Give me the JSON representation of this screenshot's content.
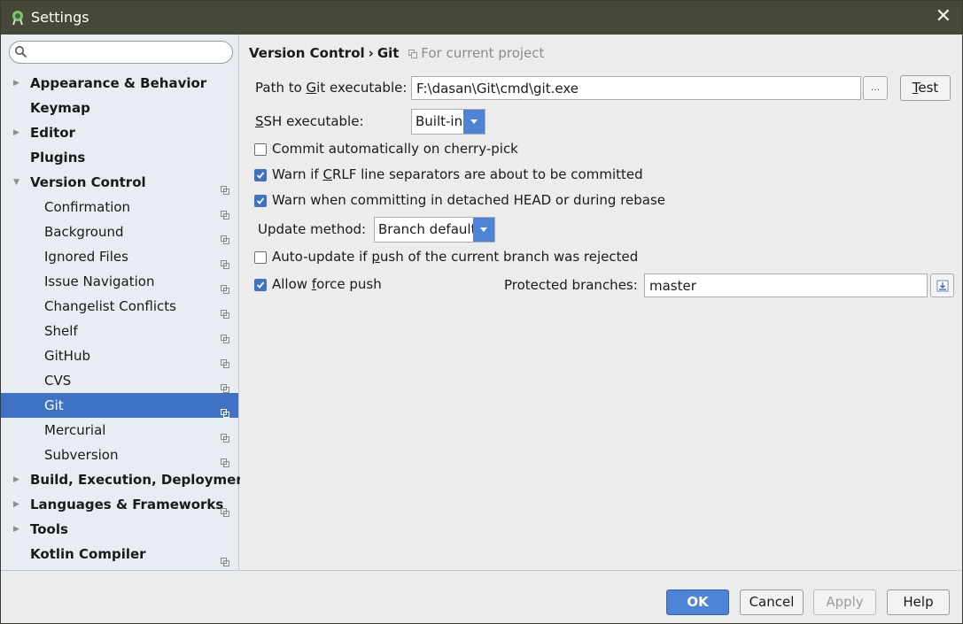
{
  "window": {
    "title": "Settings",
    "close_glyph": "✕",
    "app_icon": "android-studio-icon"
  },
  "search": {
    "placeholder": "",
    "value": ""
  },
  "tree": [
    {
      "label": "Appearance & Behavior",
      "level": 0,
      "bold": true,
      "expandable": true,
      "expanded": false,
      "project": false
    },
    {
      "label": "Keymap",
      "level": 0,
      "bold": true,
      "expandable": false,
      "project": false
    },
    {
      "label": "Editor",
      "level": 0,
      "bold": true,
      "expandable": true,
      "expanded": false,
      "project": false
    },
    {
      "label": "Plugins",
      "level": 0,
      "bold": true,
      "expandable": false,
      "project": false
    },
    {
      "label": "Version Control",
      "level": 0,
      "bold": true,
      "expandable": true,
      "expanded": true,
      "project": true
    },
    {
      "label": "Confirmation",
      "level": 1,
      "project": true
    },
    {
      "label": "Background",
      "level": 1,
      "project": true
    },
    {
      "label": "Ignored Files",
      "level": 1,
      "project": true
    },
    {
      "label": "Issue Navigation",
      "level": 1,
      "project": true
    },
    {
      "label": "Changelist Conflicts",
      "level": 1,
      "project": true
    },
    {
      "label": "Shelf",
      "level": 1,
      "project": true
    },
    {
      "label": "GitHub",
      "level": 1,
      "project": true
    },
    {
      "label": "CVS",
      "level": 1,
      "project": true
    },
    {
      "label": "Git",
      "level": 1,
      "project": true,
      "selected": true
    },
    {
      "label": "Mercurial",
      "level": 1,
      "project": true
    },
    {
      "label": "Subversion",
      "level": 1,
      "project": true
    },
    {
      "label": "Build, Execution, Deployment",
      "level": 0,
      "bold": true,
      "expandable": true,
      "expanded": false,
      "project": false
    },
    {
      "label": "Languages & Frameworks",
      "level": 0,
      "bold": true,
      "expandable": true,
      "expanded": false,
      "project": true
    },
    {
      "label": "Tools",
      "level": 0,
      "bold": true,
      "expandable": true,
      "expanded": false,
      "project": false
    },
    {
      "label": "Kotlin Compiler",
      "level": 0,
      "bold": true,
      "expandable": false,
      "project": true
    }
  ],
  "breadcrumb": {
    "parent": "Version Control",
    "separator": "›",
    "current": "Git",
    "scope": "For current project"
  },
  "git": {
    "path_label_pre": "Path to ",
    "path_label_key": "G",
    "path_label_post": "it executable:",
    "path_value": "F:\\dasan\\Git\\cmd\\git.exe",
    "browse_label": "...",
    "test_key": "T",
    "test_rest": "est",
    "ssh_label_key": "S",
    "ssh_label_rest": "SH executable:",
    "ssh_value": "Built-in",
    "commit_auto": {
      "label": "Commit automatically on cherry-pick",
      "checked": false
    },
    "warn_crlf": {
      "pre": "Warn if ",
      "key": "C",
      "post": "RLF line separators are about to be committed",
      "checked": true
    },
    "warn_detached": {
      "label": "Warn when committing in detached HEAD or during rebase",
      "checked": true
    },
    "update_method_label": "Update method:",
    "update_method_value": "Branch default",
    "auto_update": {
      "pre": "Auto-update if ",
      "key": "p",
      "post": "ush of the current branch was rejected",
      "checked": false
    },
    "force_push": {
      "pre": "Allow ",
      "key": "f",
      "post": "orce push",
      "checked": true
    },
    "protected_label": "Protected branches:",
    "protected_value": "master"
  },
  "footer": {
    "ok": "OK",
    "cancel": "Cancel",
    "apply": "Apply",
    "help": "Help"
  },
  "colors": {
    "accent": "#3f72c4",
    "titlebar": "#484838",
    "sidebar": "#e7edf2",
    "panel": "#ececec",
    "primary_button": "#4d84d6"
  }
}
